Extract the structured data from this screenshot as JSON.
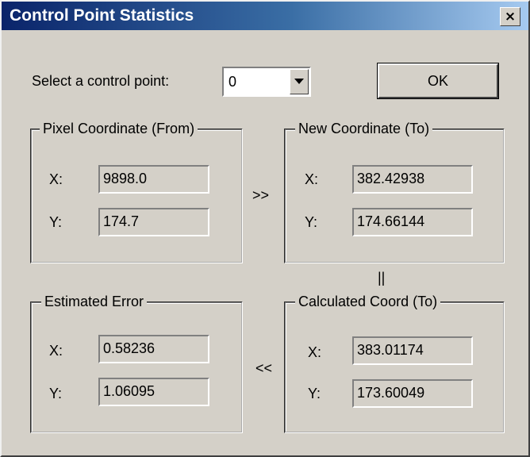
{
  "window": {
    "title": "Control Point Statistics",
    "close_glyph": "×"
  },
  "selector": {
    "label": "Select a control point:",
    "value": "0"
  },
  "ok_label": "OK",
  "groups": {
    "pixel_from": {
      "title": "Pixel Coordinate (From)",
      "x_label": "X:",
      "y_label": "Y:",
      "x": "9898.0",
      "y": "174.7"
    },
    "new_to": {
      "title": "New Coordinate (To)",
      "x_label": "X:",
      "y_label": "Y:",
      "x": "382.42938",
      "y": "174.66144"
    },
    "est_error": {
      "title": "Estimated Error",
      "x_label": "X:",
      "y_label": "Y:",
      "x": "0.58236",
      "y": "1.06095"
    },
    "calc_to": {
      "title": "Calculated Coord (To)",
      "x_label": "X:",
      "y_label": "Y:",
      "x": "383.01174",
      "y": "173.60049"
    }
  },
  "arrows": {
    "forward": ">>",
    "equals": "||",
    "back": "<<"
  },
  "colors": {
    "face": "#d4d0c8",
    "titlebar_start": "#0a246a",
    "titlebar_end": "#a6caf0"
  }
}
